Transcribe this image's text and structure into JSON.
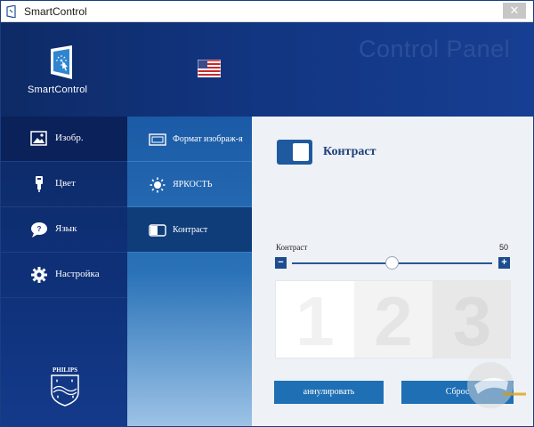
{
  "window": {
    "title": "SmartControl",
    "close_glyph": "✕"
  },
  "header": {
    "brand": "SmartControl",
    "panel_title": "Control Panel",
    "language_flag": "us-flag-icon"
  },
  "nav": {
    "items": [
      {
        "label": "Изобр.",
        "icon": "picture-icon",
        "active": true
      },
      {
        "label": "Цвет",
        "icon": "dropper-icon",
        "active": false
      },
      {
        "label": "Язык",
        "icon": "speech-bubble-icon",
        "active": false
      },
      {
        "label": "Настройка",
        "icon": "gear-icon",
        "active": false
      }
    ]
  },
  "subnav": {
    "items": [
      {
        "label": "Формат изображ-я",
        "icon": "aspect-ratio-icon",
        "active": false
      },
      {
        "label": "ЯРКОСТЬ",
        "icon": "sun-icon",
        "active": false
      },
      {
        "label": "Контраст",
        "icon": "contrast-icon",
        "active": true
      }
    ]
  },
  "content": {
    "heading": "Контраст",
    "toggle_on": true,
    "slider": {
      "label": "Контраст",
      "value": "50",
      "min": 0,
      "max": 100,
      "minus": "−",
      "plus": "+"
    },
    "preview_digits": [
      "1",
      "2",
      "3"
    ],
    "buttons": {
      "cancel": "аннулировать",
      "reset": "Сброс"
    }
  },
  "brand_logo": "philips-logo",
  "colors": {
    "header_dark": "#0e2a66",
    "accent_blue": "#1f6fb4",
    "subnav_active": "#0f3d7a"
  }
}
